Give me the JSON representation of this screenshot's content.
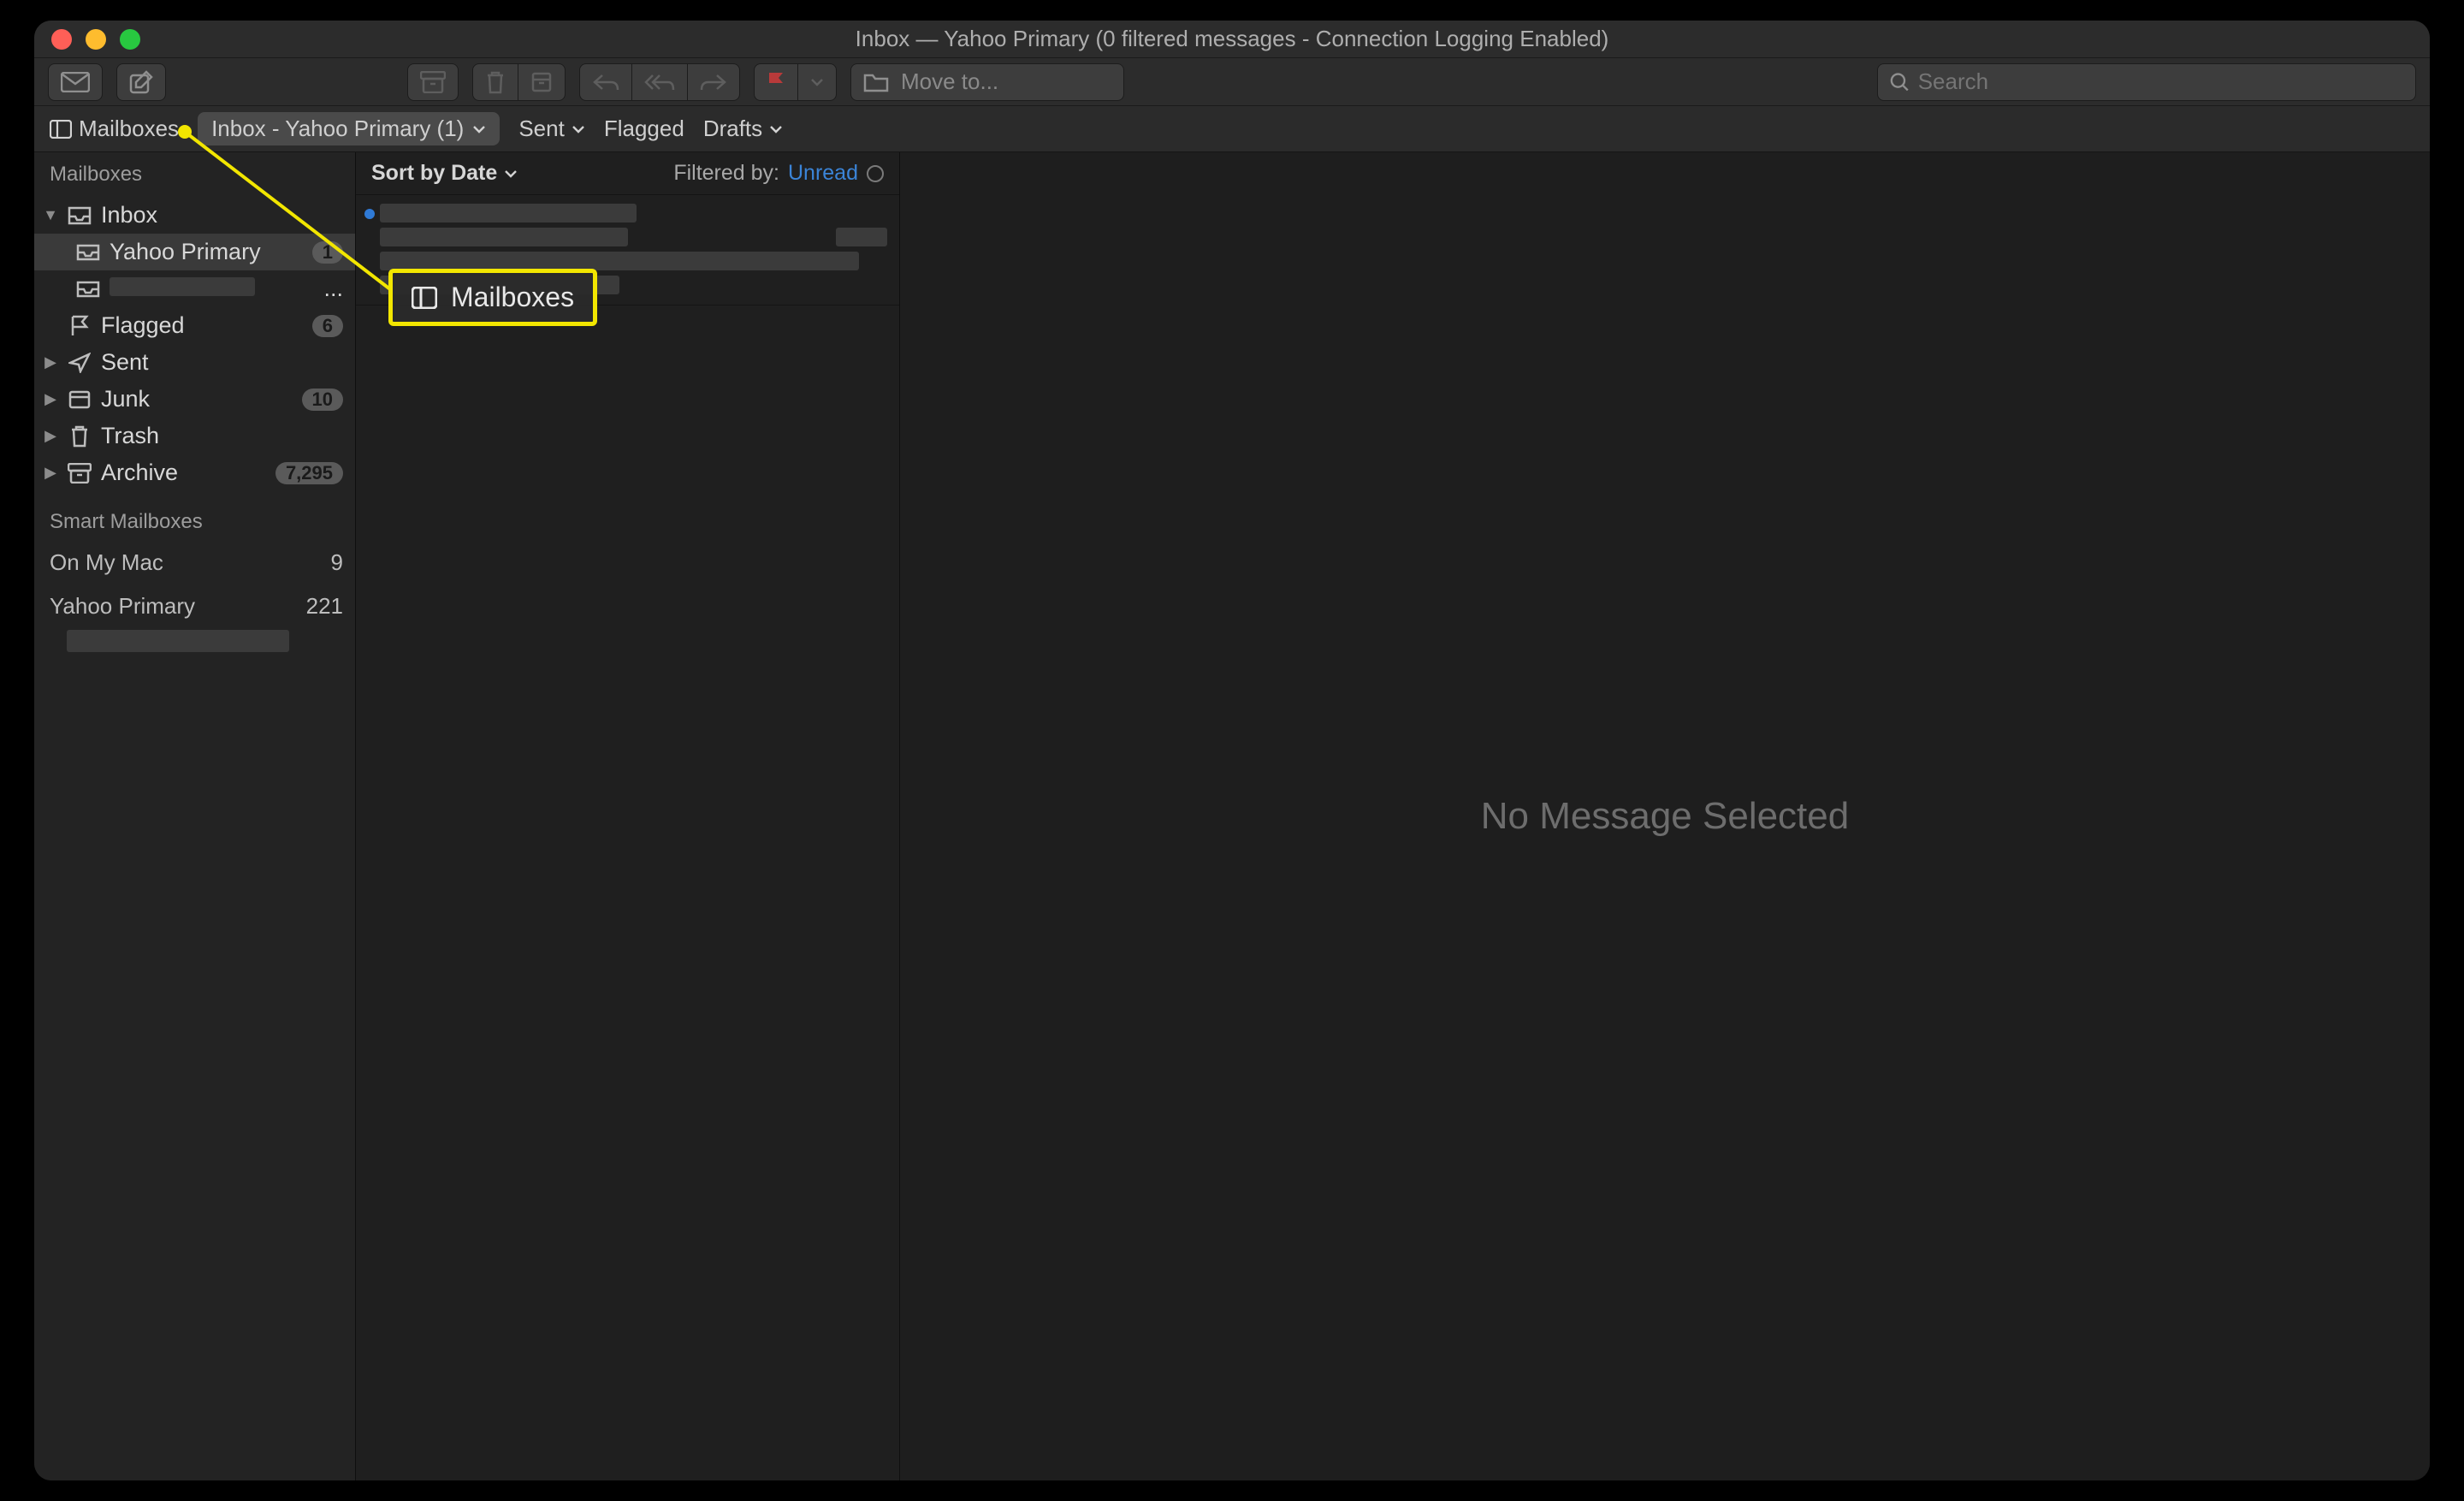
{
  "window": {
    "title": "Inbox — Yahoo Primary (0 filtered messages - Connection Logging Enabled)"
  },
  "toolbar": {
    "moveto_placeholder": "Move to...",
    "search_placeholder": "Search"
  },
  "favbar": {
    "mailboxes": "Mailboxes",
    "current_tab": "Inbox - Yahoo Primary (1)",
    "sent": "Sent",
    "flagged": "Flagged",
    "drafts": "Drafts"
  },
  "sidebar": {
    "header": "Mailboxes",
    "inbox": {
      "label": "Inbox"
    },
    "yahoo_primary": {
      "label": "Yahoo Primary",
      "count": "1"
    },
    "account2_ellipsis": "...",
    "flagged": {
      "label": "Flagged",
      "count": "6"
    },
    "sent": {
      "label": "Sent"
    },
    "junk": {
      "label": "Junk",
      "count": "10"
    },
    "trash": {
      "label": "Trash"
    },
    "archive": {
      "label": "Archive",
      "count": "7,295"
    },
    "smart_header": "Smart Mailboxes",
    "onmymac": {
      "label": "On My Mac",
      "count": "9"
    },
    "account_name": "Yahoo Primary",
    "account_count": "221"
  },
  "list": {
    "sort_label": "Sort by Date",
    "filtered_by": "Filtered by:",
    "filter_value": "Unread"
  },
  "reader": {
    "empty": "No Message Selected"
  },
  "callout": {
    "label": "Mailboxes"
  }
}
